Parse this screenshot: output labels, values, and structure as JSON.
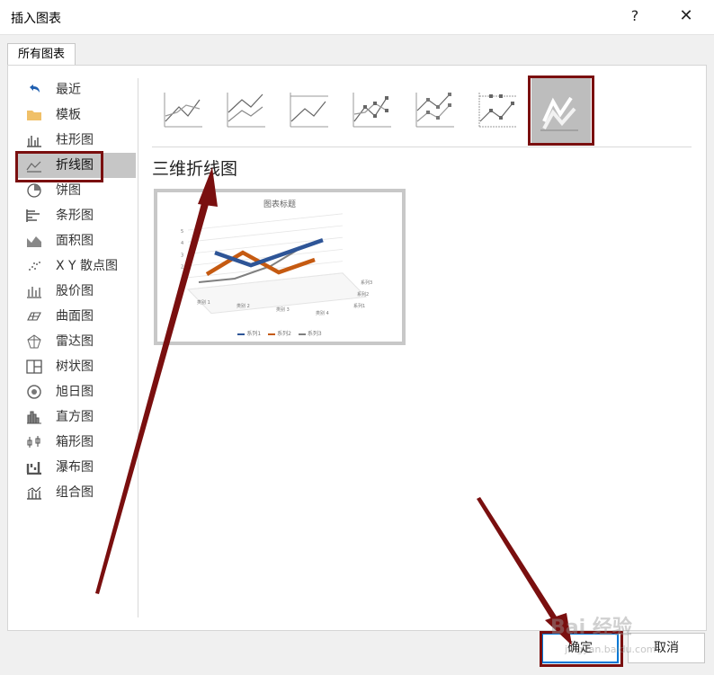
{
  "window": {
    "title": "插入图表",
    "help": "?",
    "close": "✕"
  },
  "tab": {
    "label": "所有图表"
  },
  "sidebar": {
    "items": [
      {
        "label": "最近",
        "icon": "undo-arrow-icon"
      },
      {
        "label": "模板",
        "icon": "folder-icon"
      },
      {
        "label": "柱形图",
        "icon": "column-chart-icon"
      },
      {
        "label": "折线图",
        "icon": "line-chart-icon",
        "selected": true
      },
      {
        "label": "饼图",
        "icon": "pie-chart-icon"
      },
      {
        "label": "条形图",
        "icon": "bar-chart-icon"
      },
      {
        "label": "面积图",
        "icon": "area-chart-icon"
      },
      {
        "label": "X Y 散点图",
        "icon": "scatter-chart-icon"
      },
      {
        "label": "股价图",
        "icon": "stock-chart-icon"
      },
      {
        "label": "曲面图",
        "icon": "surface-chart-icon"
      },
      {
        "label": "雷达图",
        "icon": "radar-chart-icon"
      },
      {
        "label": "树状图",
        "icon": "treemap-chart-icon"
      },
      {
        "label": "旭日图",
        "icon": "sunburst-chart-icon"
      },
      {
        "label": "直方图",
        "icon": "histogram-chart-icon"
      },
      {
        "label": "箱形图",
        "icon": "box-whisker-chart-icon"
      },
      {
        "label": "瀑布图",
        "icon": "waterfall-chart-icon"
      },
      {
        "label": "组合图",
        "icon": "combo-chart-icon"
      }
    ]
  },
  "subtypes": [
    {
      "icon": "line-icon"
    },
    {
      "icon": "stacked-line-icon"
    },
    {
      "icon": "percent-stacked-line-icon"
    },
    {
      "icon": "line-markers-icon"
    },
    {
      "icon": "stacked-line-markers-icon"
    },
    {
      "icon": "percent-stacked-line-markers-icon"
    },
    {
      "icon": "3d-line-icon",
      "selected": true
    }
  ],
  "selected_chart": {
    "heading": "三维折线图"
  },
  "preview": {
    "title": "图表标题",
    "chart_data": {
      "type": "line",
      "title": "图表标题",
      "categories": [
        "类别 1",
        "类别 2",
        "类别 3",
        "类别 4"
      ],
      "series": [
        {
          "name": "系列1",
          "values": [
            4.3,
            2.5,
            3.5,
            4.5
          ],
          "color": "#2e5597"
        },
        {
          "name": "系列2",
          "values": [
            2.4,
            4.4,
            1.8,
            2.8
          ],
          "color": "#c55a11"
        },
        {
          "name": "系列3",
          "values": [
            2.0,
            2.0,
            3.0,
            5.0
          ],
          "color": "#7f7f7f"
        }
      ],
      "y_ticks": [
        "0",
        "1",
        "2",
        "3",
        "4",
        "5"
      ],
      "depth_labels": [
        "系列3",
        "系列2",
        "系列1"
      ]
    }
  },
  "buttons": {
    "ok": "确定",
    "cancel": "取消"
  },
  "watermark": {
    "text": "Bai 经验",
    "sub": "jingyan.baidu.com"
  },
  "colors": {
    "highlight": "#7a0f0f",
    "selected_bg": "#c6c6c6",
    "accent": "#0078d7"
  }
}
